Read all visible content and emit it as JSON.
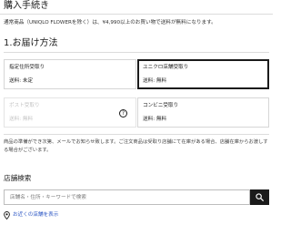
{
  "page": {
    "title": "購入手続き",
    "shipping_notice": "通常商品（UNIQLO FLOWERを除く）は、¥4,990以上のお買い物で送料が無料になります。"
  },
  "delivery": {
    "section_title": "1.お届け方法",
    "options": [
      {
        "name": "指定住所受取り",
        "fee": "送料: 未定",
        "selected": false,
        "disabled": false
      },
      {
        "name": "ユニクロ店舗受取り",
        "fee": "送料: 無料",
        "selected": true,
        "disabled": false
      },
      {
        "name": "ポスト受取り",
        "fee": "送料: 無料",
        "selected": false,
        "disabled": true,
        "help_icon": "?"
      },
      {
        "name": "コンビニ受取り",
        "fee": "送料: 無料",
        "selected": false,
        "disabled": false
      }
    ],
    "notice": "商品の準備ができ次第、メールでお知らせ致します。ご注文商品は受取り店舗にて在庫がある場合、店舗在庫からお渡しする場合がございます。"
  },
  "store_search": {
    "title": "店舗検索",
    "placeholder": "店舗名・住所・キーワードで検索",
    "search_icon": "search-icon",
    "nearby_label": "お近くの店舗を表示",
    "nearby_icon": "location-pin-icon"
  },
  "colors": {
    "text": "#1b1b1b",
    "link": "#2a55c4",
    "disabled_text": "#c4c4c4",
    "button_bg": "#1b1b1b"
  }
}
